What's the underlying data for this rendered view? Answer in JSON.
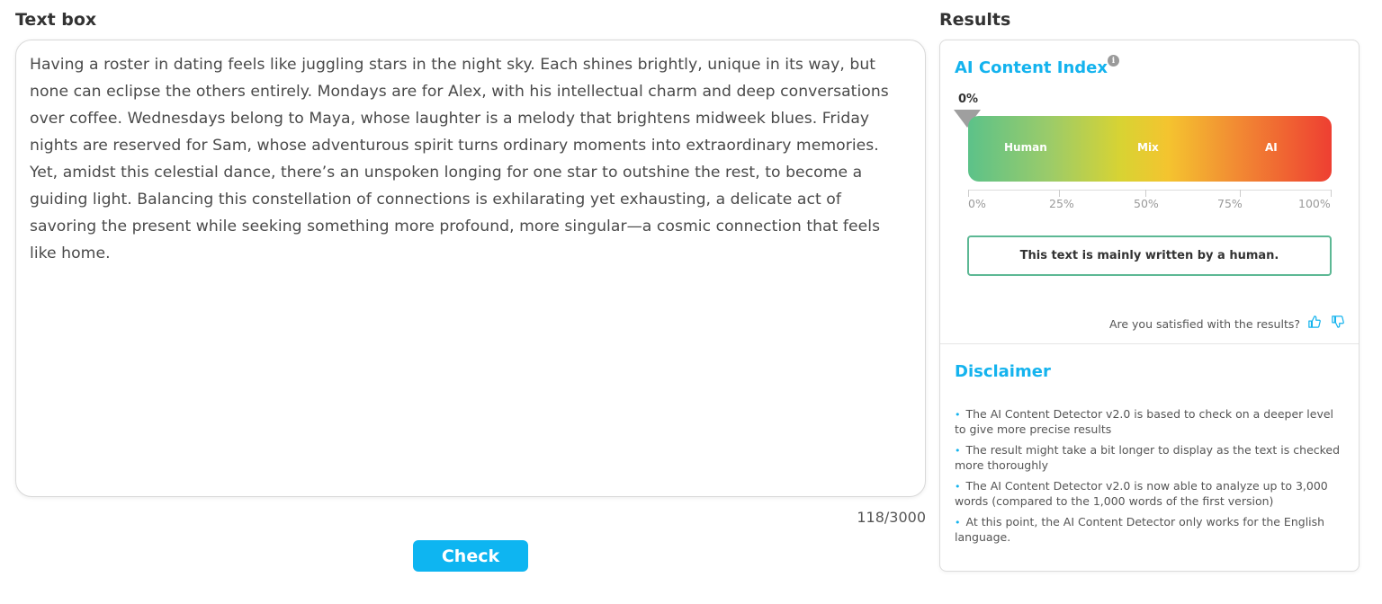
{
  "textbox": {
    "title": "Text box",
    "content": "Having a roster in dating feels like juggling stars in the night sky. Each shines brightly, unique in its way, but none can eclipse the others entirely. Mondays are for Alex, with his intellectual charm and deep conversations over coffee. Wednesdays belong to Maya, whose laughter is a melody that brightens midweek blues. Friday nights are reserved for Sam, whose adventurous spirit turns ordinary moments into extraordinary memories. Yet, amidst this celestial dance, there’s an unspoken longing for one star to outshine the rest, to become a guiding light. Balancing this constellation of connections is exhilarating yet exhausting, a delicate act of savoring the present while seeking something more profound, more singular—a cosmic connection that feels like home.",
    "char_count": "118/3000",
    "check_label": "Check"
  },
  "results": {
    "title": "Results",
    "ai_index_title": "AI Content Index",
    "info_icon": "i",
    "pointer_value": "0%",
    "pointer_fraction": 0.0,
    "bar_labels": {
      "human": "Human",
      "mix": "Mix",
      "ai": "AI"
    },
    "scale": [
      "0%",
      "25%",
      "50%",
      "75%",
      "100%"
    ],
    "verdict": "This text is mainly written by a human.",
    "satisfied": "Are you satisfied with the results?",
    "accent_color": "#14b3ee",
    "verdict_border_color": "#5cb894"
  },
  "disclaimer": {
    "title": "Disclaimer",
    "bullet": "•",
    "items": [
      "The AI Content Detector v2.0 is based to check on a deeper level to give more precise results",
      "The result might take a bit longer to display as the text is checked more thoroughly",
      "The AI Content Detector v2.0 is now able to analyze up to 3,000 words (compared to the 1,000 words of the first version)",
      "At this point, the AI Content Detector only works for the English language."
    ]
  }
}
